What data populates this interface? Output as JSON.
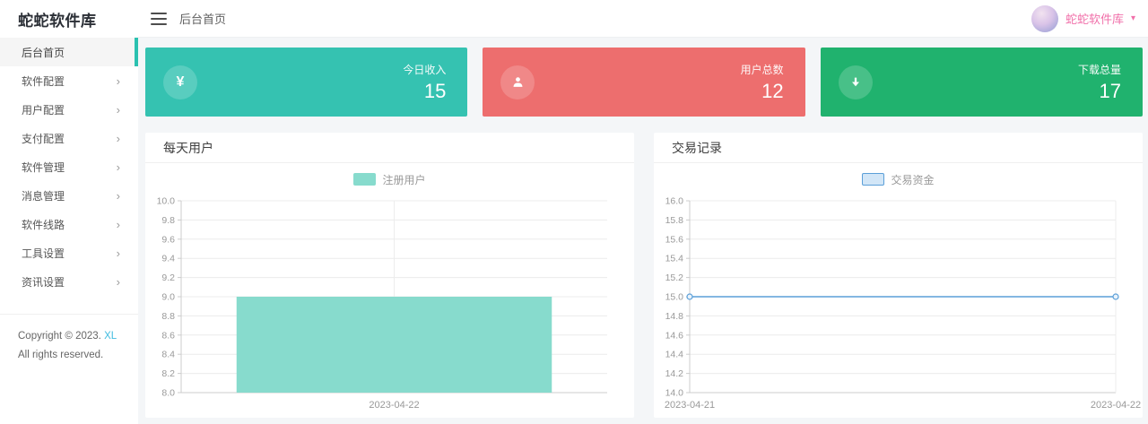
{
  "sidebar": {
    "logo": "蛇蛇软件库",
    "chevron": "›",
    "items": [
      {
        "label": "后台首页",
        "active": true
      },
      {
        "label": "软件配置"
      },
      {
        "label": "用户配置"
      },
      {
        "label": "支付配置"
      },
      {
        "label": "软件管理"
      },
      {
        "label": "消息管理"
      },
      {
        "label": "软件线路"
      },
      {
        "label": "工具设置"
      },
      {
        "label": "资讯设置"
      }
    ],
    "copyright": {
      "prefix": "Copyright © 2023.",
      "link": "XL",
      "suffix": "All rights reserved."
    },
    "active_color": "#2bc1b0"
  },
  "header": {
    "breadcrumb": "后台首页",
    "username": "蛇蛇软件库",
    "caret": "▾",
    "username_color": "#f170aa"
  },
  "stats": [
    {
      "label": "今日收入",
      "value": "15",
      "color": "#35c2b1",
      "icon": "yen-icon",
      "glyph": "¥"
    },
    {
      "label": "用户总数",
      "value": "12",
      "color": "#ed6e6e",
      "icon": "user-icon"
    },
    {
      "label": "下载总量",
      "value": "17",
      "color": "#20b26e",
      "icon": "download-icon"
    }
  ],
  "panels": [
    {
      "title": "每天用户"
    },
    {
      "title": "交易记录"
    }
  ],
  "chart_data": [
    {
      "type": "bar",
      "title": "每天用户",
      "categories": [
        "2023-04-22"
      ],
      "series": [
        {
          "name": "注册用户",
          "values": [
            9.0
          ]
        }
      ],
      "ylim": [
        8.0,
        10.0
      ],
      "ytick_step": 0.2,
      "ytick_labels": [
        "8.0",
        "8.2",
        "8.4",
        "8.6",
        "8.8",
        "9.0",
        "9.2",
        "9.4",
        "9.6",
        "9.8",
        "10.0"
      ],
      "color": "#87dbcd",
      "grid": true,
      "legend_position": "top"
    },
    {
      "type": "line",
      "title": "交易记录",
      "x": [
        "2023-04-21",
        "2023-04-22"
      ],
      "series": [
        {
          "name": "交易资金",
          "values": [
            15.0,
            15.0
          ]
        }
      ],
      "ylim": [
        14.0,
        16.0
      ],
      "ytick_step": 0.2,
      "ytick_labels": [
        "14.0",
        "14.2",
        "14.4",
        "14.6",
        "14.8",
        "15.0",
        "15.2",
        "15.4",
        "15.6",
        "15.8",
        "16.0"
      ],
      "color": "#5b9fd8",
      "legend_fill": "#d2e6f7",
      "marker": "hollow-circle",
      "grid": true,
      "legend_position": "top"
    }
  ]
}
